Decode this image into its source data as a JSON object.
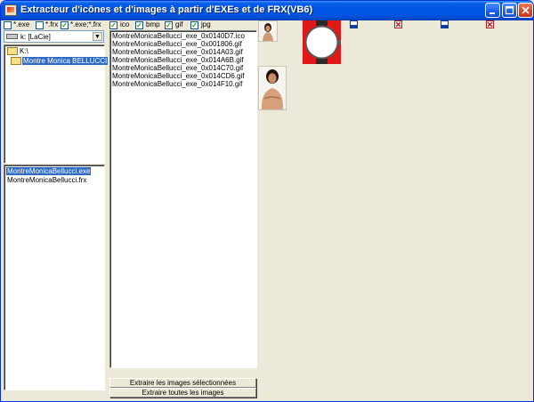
{
  "window": {
    "title": "Extracteur d'icônes et d'images à partir d'EXEs et de FRX(VB6)",
    "buttons": {
      "minimize": "_",
      "maximize": "□",
      "close": "✕"
    }
  },
  "file_filters": [
    {
      "label": "*.exe",
      "checked": false
    },
    {
      "label": "*.frx",
      "checked": false
    },
    {
      "label": "*.exe;*.frx",
      "checked": true
    }
  ],
  "image_filters": [
    {
      "label": "ico",
      "checked": true
    },
    {
      "label": "bmp",
      "checked": true
    },
    {
      "label": "gif",
      "checked": true
    },
    {
      "label": "jpg",
      "checked": true
    }
  ],
  "drive": {
    "selected": "k: [LaCie]"
  },
  "folders": [
    {
      "label": "K:\\",
      "selected": false
    },
    {
      "label": "Montre Monica BELLUCCI",
      "selected": true
    }
  ],
  "files": [
    {
      "label": "MontreMonicaBellucci.exe",
      "selected": true
    },
    {
      "label": "MontreMonicaBellucci.frx",
      "selected": false
    }
  ],
  "images": [
    "MontreMonicaBellucci_exe_0x0140D7.ico",
    "MontreMonicaBellucci_exe_0x001806.gif",
    "MontreMonicaBellucci_exe_0x014A03.gif",
    "MontreMonicaBellucci_exe_0x014A6B.gif",
    "MontreMonicaBellucci_exe_0x014C70.gif",
    "MontreMonicaBellucci_exe_0x014CD6.gif",
    "MontreMonicaBellucci_exe_0x014F10.gif"
  ],
  "actions": {
    "extract_selected": "Extraire les images sélectionnées",
    "extract_all": "Extraire toutes les images"
  },
  "colors": {
    "titlebar": "#0054e3",
    "selection": "#316ac5",
    "check": "#21a121",
    "watch_red": "#e01818"
  }
}
